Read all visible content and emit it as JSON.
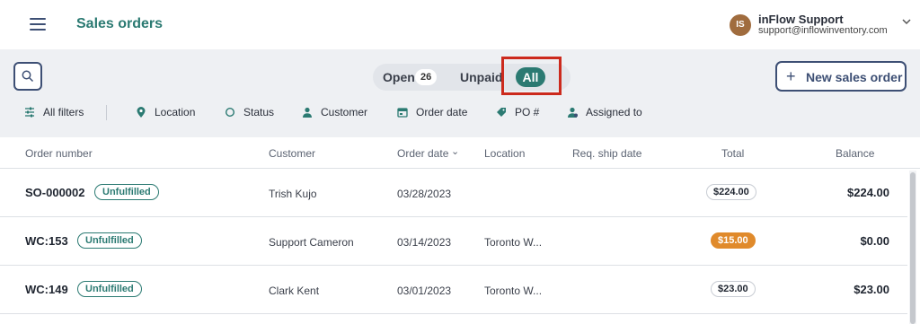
{
  "header": {
    "title": "Sales orders",
    "user": {
      "initials": "IS",
      "name": "inFlow Support",
      "email": "support@inflowinventory.com"
    }
  },
  "toolbar": {
    "segments": {
      "open_label": "Open",
      "open_count": "26",
      "unpaid_label": "Unpaid",
      "all_label": "All"
    },
    "new_order_label": "New sales order"
  },
  "filters": [
    {
      "label": "All filters",
      "icon": "sliders-icon"
    },
    {
      "label": "Location",
      "icon": "map-pin-icon"
    },
    {
      "label": "Status",
      "icon": "circle-icon"
    },
    {
      "label": "Customer",
      "icon": "person-icon"
    },
    {
      "label": "Order date",
      "icon": "calendar-icon"
    },
    {
      "label": "PO #",
      "icon": "tag-icon"
    },
    {
      "label": "Assigned to",
      "icon": "person-assigned-icon"
    }
  ],
  "table": {
    "columns": [
      "Order number",
      "Customer",
      "Order date",
      "Location",
      "Req. ship date",
      "Total",
      "Balance"
    ],
    "sort_indicator": "⌄",
    "rows": [
      {
        "order": "SO-000002",
        "status": "Unfulfilled",
        "customer": "Trish Kujo",
        "date": "03/28/2023",
        "location": "",
        "ship": "",
        "total": "$224.00",
        "balance": "$224.00",
        "total_style": "plain"
      },
      {
        "order": "WC:153",
        "status": "Unfulfilled",
        "customer": "Support Cameron",
        "date": "03/14/2023",
        "location": "Toronto W...",
        "ship": "",
        "total": "$15.00",
        "balance": "$0.00",
        "total_style": "orange"
      },
      {
        "order": "WC:149",
        "status": "Unfulfilled",
        "customer": "Clark Kent",
        "date": "03/01/2023",
        "location": "Toronto W...",
        "ship": "",
        "total": "$23.00",
        "balance": "$23.00",
        "total_style": "plain"
      }
    ]
  },
  "colors": {
    "accent": "#2b7a72",
    "navy": "#3d4f74",
    "highlight": "#cc2a1d",
    "orange": "#e08a2b"
  }
}
